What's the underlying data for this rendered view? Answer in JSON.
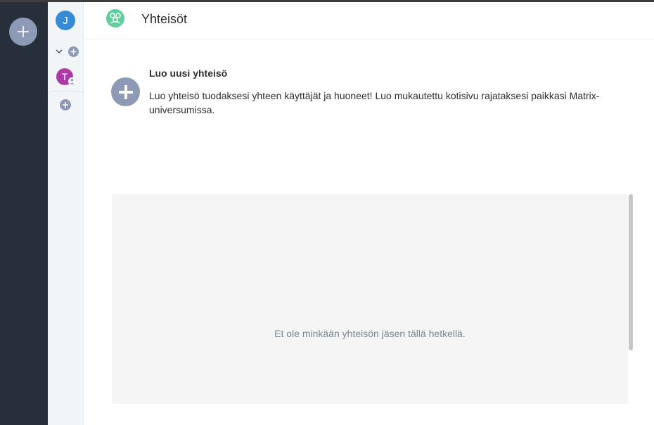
{
  "window": {
    "title": "Yhteisöt"
  },
  "sidebar": {
    "user_initial": "J",
    "dm_initial": "T"
  },
  "header": {
    "title": "Yhteisöt",
    "icon": "community-icon"
  },
  "create_group": {
    "title": "Luo uusi yhteisö",
    "description": "Luo yhteisö tuodaksesi yhteen käyttäjät ja huoneet! Luo mukautettu kotisivu rajataksesi paikkasi Matrix-universumissa.",
    "icon": "plus-circle-icon"
  },
  "empty_state": {
    "text": "Et ole minkään yhteisön jäsen tällä hetkellä."
  },
  "colors": {
    "rail": "#27303a",
    "accent_icon": "#8d99b5",
    "community_icon": "#5fcf9d",
    "user_avatar": "#368bd6",
    "dm_avatar": "#ac3ba8"
  }
}
